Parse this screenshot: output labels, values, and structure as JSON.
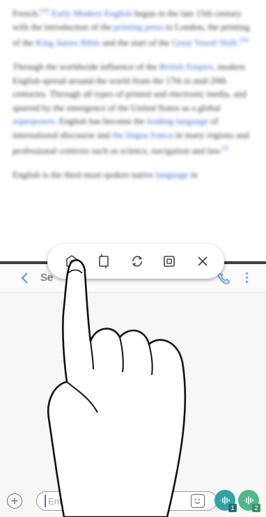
{
  "article": {
    "p1": {
      "t1": "French.",
      "ref1": "[19]",
      "link1": "Early Modern English",
      "t2": " began in the late 15th century with the introduction of the ",
      "link2": "printing press",
      "t3": " to London, the printing of the ",
      "link3": "King James Bible",
      "t4": " and the start of the ",
      "link4": "Great Vowel Shift",
      "t5": ".",
      "ref2": "[20]"
    },
    "p2": {
      "t1": "Through the worldwide influence of the ",
      "link1": "British Empire",
      "t2": ", modern English spread around the world from the 17th to mid-20th centuries. Through all types of printed and electronic media, and spurred by the emergence of the United States as a global ",
      "link2": "superpower",
      "t3": ", English has become the ",
      "link3": "leading language",
      "t4": " of international discourse and ",
      "link4": "the lingua franca",
      "t5": " in many regions and professional contexts such as science, navigation and law.",
      "ref1": "[5]"
    },
    "p3": {
      "t1": "English is the third most spoken native ",
      "link1": "language",
      "t2": " in"
    }
  },
  "messages": {
    "contact_name": "Se"
  },
  "composer": {
    "add_symbol": "+",
    "input_placeholder": "Enter message",
    "sim1_badge": "1",
    "sim2_badge": "2"
  },
  "toolbar": {
    "icons": [
      "add-to-apps-edge-icon",
      "switch-windows-icon",
      "rotate-icon",
      "resize-window-icon",
      "close-icon"
    ]
  },
  "colors": {
    "link": "#3a6fd8",
    "accent": "#3f8ed8",
    "divider": "#3b3b3b",
    "sim1": "#2fa3a7",
    "sim2": "#4fb889"
  }
}
